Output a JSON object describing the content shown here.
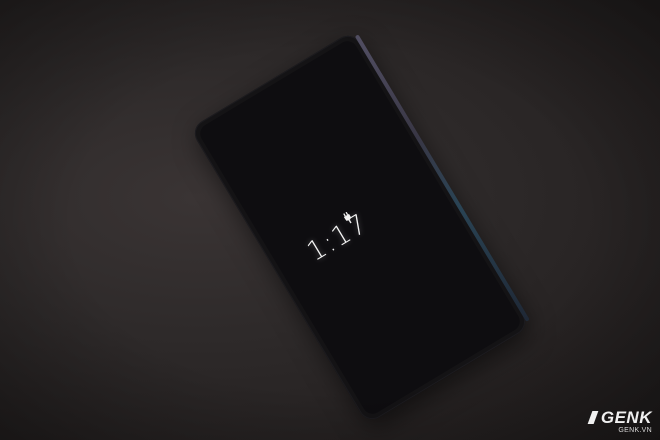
{
  "photo": {
    "subject": "smartphone-always-on-display"
  },
  "screen": {
    "time": "1:17",
    "status_icon": "charging-plug-icon"
  },
  "watermark": {
    "brand": "GENK",
    "url": "GENK.VN"
  },
  "colors": {
    "background": "#2a2626",
    "phone_body": "#141315",
    "clock_text": "#f4f4f4"
  }
}
